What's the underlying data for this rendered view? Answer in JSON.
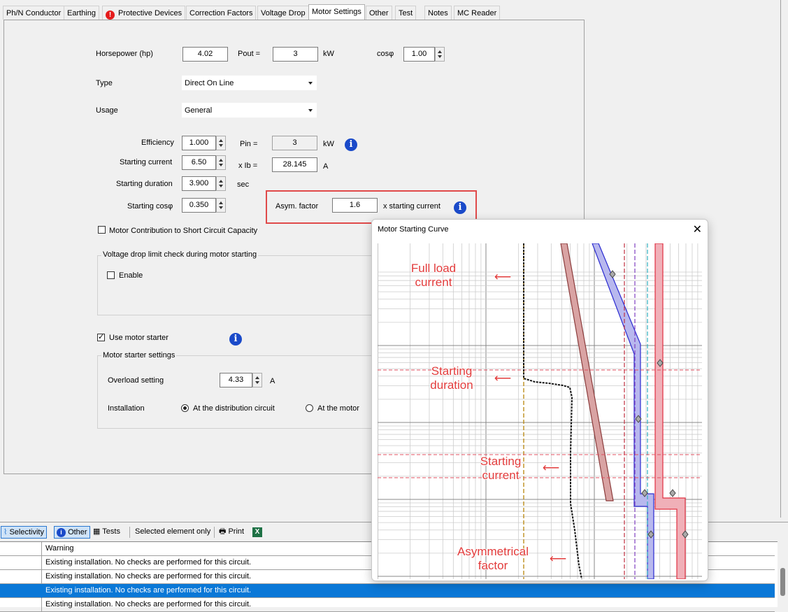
{
  "tabs": [
    {
      "label": "Ph/N Conductor",
      "active": false
    },
    {
      "label": "Earthing",
      "active": false
    },
    {
      "label": "Protective Devices",
      "active": false,
      "warning": true
    },
    {
      "label": "Correction Factors",
      "active": false
    },
    {
      "label": "Voltage Drop",
      "active": false
    },
    {
      "label": "Motor Settings",
      "active": true
    },
    {
      "label": "Other",
      "active": false
    },
    {
      "label": "Test",
      "active": false
    },
    {
      "label": "Notes",
      "active": false
    },
    {
      "label": "MC Reader",
      "active": false
    }
  ],
  "form": {
    "horsepower_label": "Horsepower (hp)",
    "horsepower_value": "4.02",
    "pout_label": "Pout =",
    "pout_value": "3",
    "pout_unit": "kW",
    "cosphi_label": "cosφ",
    "cosphi_value": "1.00",
    "type_label": "Type",
    "type_value": "Direct On Line",
    "usage_label": "Usage",
    "usage_value": "General",
    "efficiency_label": "Efficiency",
    "efficiency_value": "1.000",
    "pin_label": "Pin =",
    "pin_value": "3",
    "pin_unit": "kW",
    "starting_current_label": "Starting current",
    "starting_current_value": "6.50",
    "xib_label": "x Ib =",
    "xib_value": "28.145",
    "xib_unit": "A",
    "starting_duration_label": "Starting duration",
    "starting_duration_value": "3.900",
    "starting_duration_unit": "sec",
    "starting_cosphi_label": "Starting cosφ",
    "starting_cosphi_value": "0.350",
    "asym_label": "Asym. factor",
    "asym_value": "1.6",
    "asym_unit": "x starting current",
    "motor_contribution_label": "Motor Contribution to Short Circuit Capacity",
    "motor_contribution_checked": false,
    "vdrop_group_label": "Voltage drop limit check during motor starting",
    "enable_label": "Enable",
    "enable_checked": false,
    "use_motor_starter_label": "Use motor starter",
    "use_motor_starter_checked": true,
    "starter_group_label": "Motor starter settings",
    "overload_label": "Overload setting",
    "overload_value": "4.33",
    "overload_unit": "A",
    "installation_label": "Installation",
    "install_option1": "At the distribution circuit",
    "install_option2": "At the motor",
    "install_selected": "At the distribution circuit"
  },
  "toolbar": {
    "selectivity": "Selectivity",
    "other": "Other",
    "tests": "Tests",
    "selected_only": "Selected element only",
    "print": "Print"
  },
  "grid": {
    "header": "Warning",
    "rows": [
      "Existing installation. No checks are performed for this circuit.",
      "Existing installation. No checks are performed for this circuit.",
      "Existing installation. No checks are performed for this circuit.",
      "Existing installation. No checks are performed for this circuit."
    ],
    "selected_row": 2
  },
  "popup": {
    "title": "Motor Starting Curve",
    "annotations": {
      "full_load": "Full load\ncurrent",
      "starting_duration": "Starting\nduration",
      "starting_current": "Starting\ncurrent",
      "asym": "Asymmetrical\nfactor"
    }
  },
  "colors": {
    "accent": "#0a78d7",
    "annotation": "#e23b3b",
    "info": "#1a4ac9",
    "curve_blue": "#3a3ad0",
    "curve_red": "#e03040",
    "curve_brown": "#a05050"
  }
}
